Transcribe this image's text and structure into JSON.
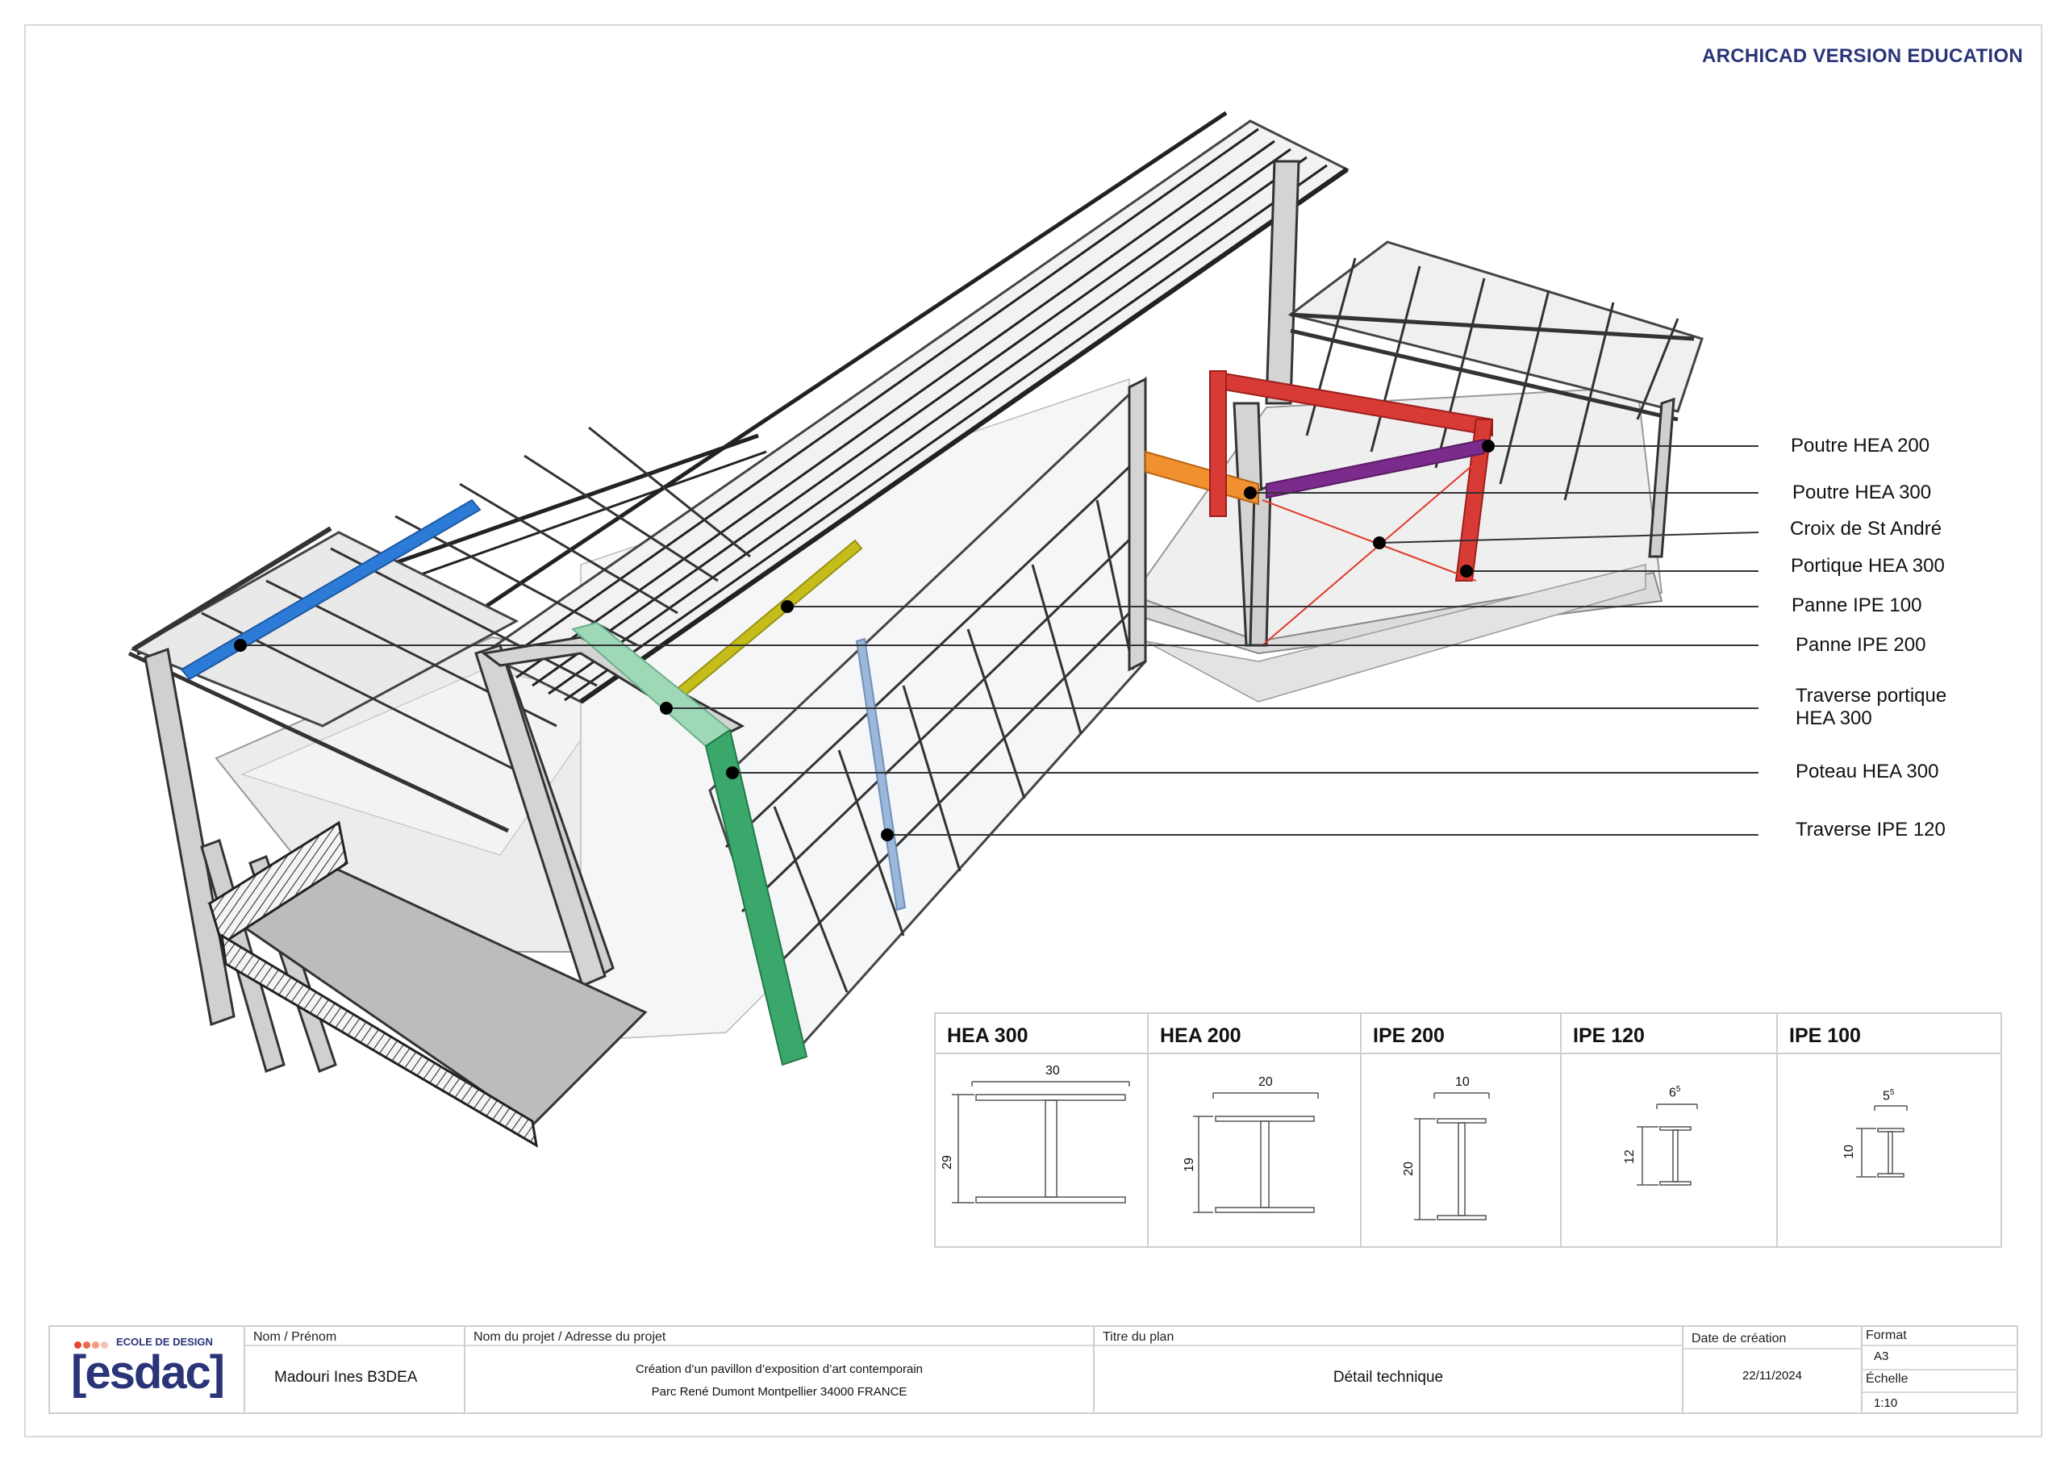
{
  "watermark": "ARCHICAD VERSION EDUCATION",
  "callouts": [
    {
      "label": "Poutre HEA 200",
      "color": "#e03a2a"
    },
    {
      "label": "Poutre HEA 300",
      "color": "#7b2b8b"
    },
    {
      "label": "Croix de St André",
      "color": "#e03a2a"
    },
    {
      "label": "Portique HEA 300",
      "color": "#d83a35"
    },
    {
      "label": "Panne IPE 100",
      "color": "#c4bd1c"
    },
    {
      "label": "Panne IPE 200",
      "color": "#2c7bd6"
    },
    {
      "label": "Traverse portique\nHEA 300",
      "color": "#9ed8b7"
    },
    {
      "label": "Poteau HEA 300",
      "color": "#3aa86a"
    },
    {
      "label": "Traverse IPE 120",
      "color": "#9bb8dc"
    }
  ],
  "profiles": [
    {
      "name": "HEA 300",
      "width_label": "30",
      "height_label": "29"
    },
    {
      "name": "HEA 200",
      "width_label": "20",
      "height_label": "19"
    },
    {
      "name": "IPE 200",
      "width_label": "10",
      "height_label": "20"
    },
    {
      "name": "IPE 120",
      "width_label": "6",
      "width_sup": "5",
      "height_label": "12"
    },
    {
      "name": "IPE 100",
      "width_label": "5",
      "width_sup": "5",
      "height_label": "10"
    }
  ],
  "title_block": {
    "logo_sub": "ECOLE DE DESIGN",
    "logo_main": "[esdac]",
    "logo_dot_colors": [
      "#e8442f",
      "#ef6a4e",
      "#f59a80",
      "#f7c2b4"
    ],
    "name_label": "Nom / Prénom",
    "name_value": "Madouri Ines B3DEA",
    "project_label": "Nom du projet / Adresse du projet",
    "project_line1": "Création d’un pavillon d’exposition d’art contemporain",
    "project_line2": "Parc René Dumont  Montpellier 34000 FRANCE",
    "plan_label": "Titre du plan",
    "plan_value": "Détail technique",
    "date_label": "Date de création",
    "date_value": "22/11/2024",
    "format_label": "Format",
    "format_value": "A3",
    "scale_label": "Échelle",
    "scale_value": "1:10"
  }
}
